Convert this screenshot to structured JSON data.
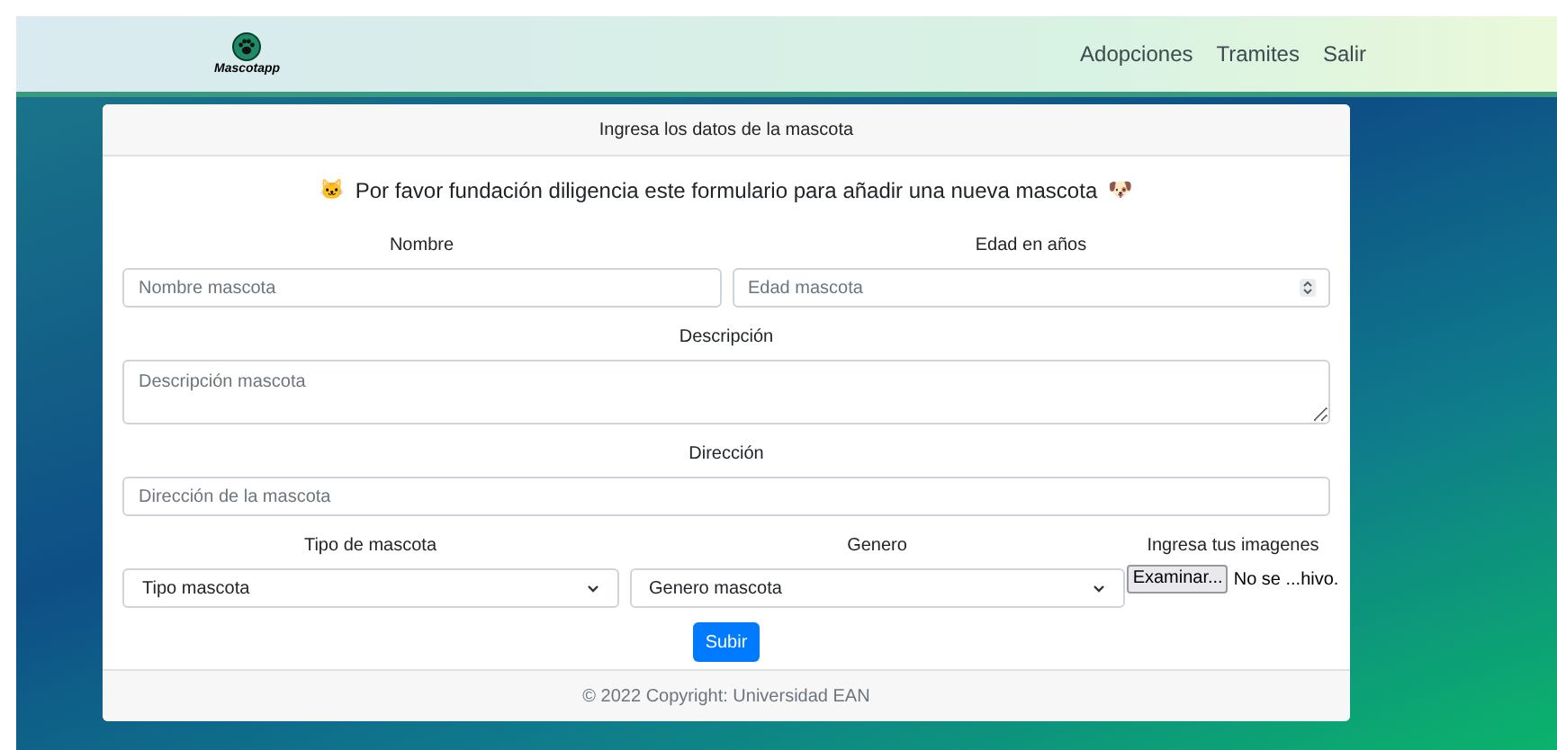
{
  "navbar": {
    "logo_text": "Mascotapp",
    "links": [
      {
        "label": "Adopciones"
      },
      {
        "label": "Tramites"
      },
      {
        "label": "Salir"
      }
    ]
  },
  "card": {
    "header": "Ingresa los datos de la mascota",
    "intro": {
      "lead_emoji": "🐱",
      "text": "Por favor fundación diligencia este formulario para añadir una nueva mascota",
      "trail_emoji": "🐶"
    },
    "rows": [
      {
        "fields": [
          {
            "kind": "text",
            "label": "Nombre",
            "placeholder": "Nombre mascota"
          },
          {
            "kind": "number",
            "label": "Edad en años",
            "placeholder": "Edad mascota"
          }
        ]
      },
      {
        "fields": [
          {
            "kind": "textarea",
            "label": "Descripción",
            "placeholder": "Descripción mascota"
          }
        ]
      },
      {
        "fields": [
          {
            "kind": "text",
            "label": "Dirección",
            "placeholder": "Dirección de la mascota"
          }
        ]
      },
      {
        "fields": [
          {
            "kind": "select",
            "label": "Tipo de mascota",
            "value": "Tipo mascota"
          },
          {
            "kind": "select",
            "label": "Genero",
            "value": "Genero mascota"
          },
          {
            "kind": "file",
            "label": "Ingresa tus imagenes",
            "button": "Examinar...",
            "value": "No se ...hivo."
          }
        ]
      }
    ],
    "submit": "Subir",
    "footer": "© 2022 Copyright: Universidad EAN"
  }
}
